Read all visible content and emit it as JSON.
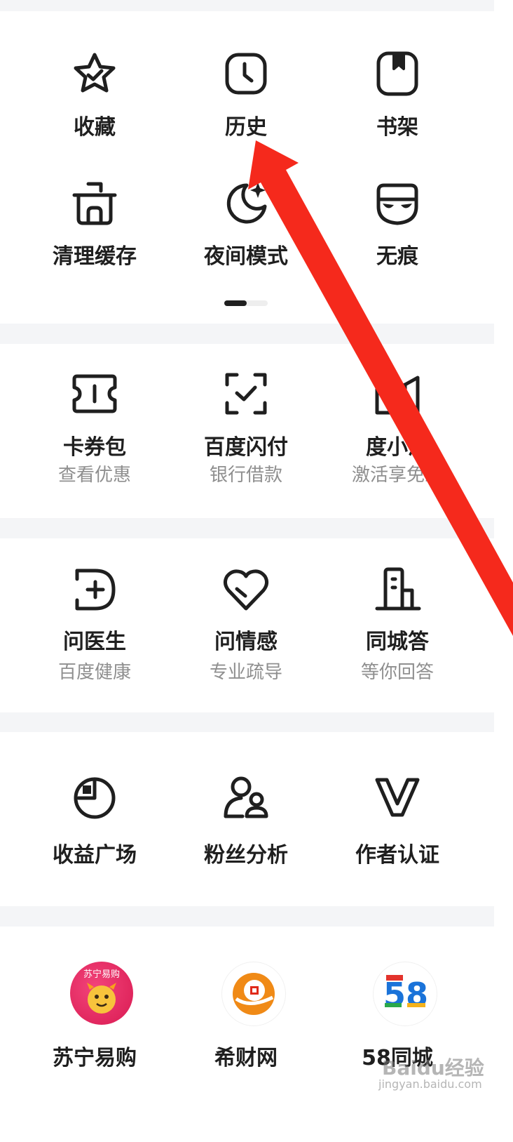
{
  "grid1": {
    "items": [
      {
        "label": "收藏"
      },
      {
        "label": "历史"
      },
      {
        "label": "书架"
      },
      {
        "label": "清理缓存"
      },
      {
        "label": "夜间模式"
      },
      {
        "label": "无痕"
      }
    ]
  },
  "finance": {
    "items": [
      {
        "label": "卡券包",
        "sub": "查看优惠"
      },
      {
        "label": "百度闪付",
        "sub": "银行借款"
      },
      {
        "label": "度小满",
        "sub": "激活享免息"
      }
    ]
  },
  "health": {
    "items": [
      {
        "label": "问医生",
        "sub": "百度健康"
      },
      {
        "label": "问情感",
        "sub": "专业疏导"
      },
      {
        "label": "同城答",
        "sub": "等你回答"
      }
    ]
  },
  "creator": {
    "items": [
      {
        "label": "收益广场"
      },
      {
        "label": "粉丝分析"
      },
      {
        "label": "作者认证"
      }
    ]
  },
  "partners": {
    "items": [
      {
        "label": "苏宁易购",
        "logo_text": "苏宁易购"
      },
      {
        "label": "希财网"
      },
      {
        "label": "58同城",
        "logo_text": "58"
      }
    ]
  },
  "watermark": {
    "text": "Baidu经验",
    "sub": "jingyan.baidu.com"
  },
  "colors": {
    "arrow": "#f5291c",
    "suning": "#e8265b",
    "xicai": "#f08a16"
  }
}
